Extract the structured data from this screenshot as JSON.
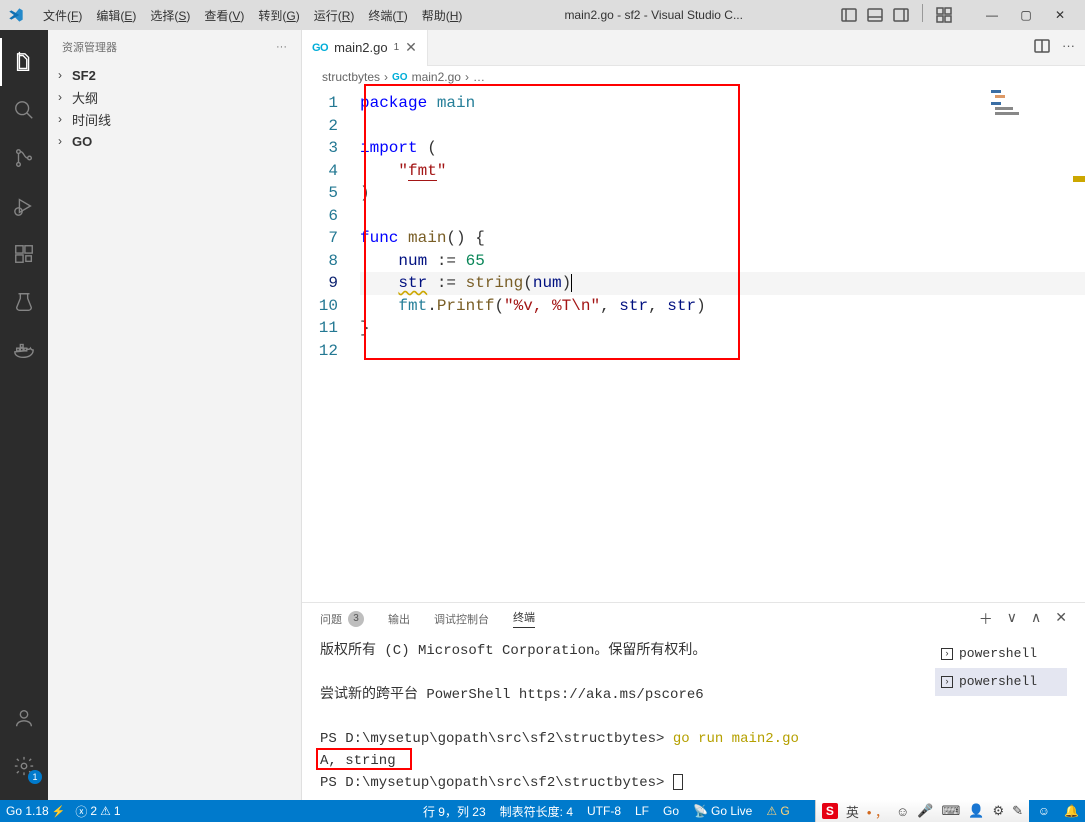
{
  "titlebar": {
    "menu": [
      "文件(F)",
      "编辑(E)",
      "选择(S)",
      "查看(V)",
      "转到(G)",
      "运行(R)",
      "终端(T)",
      "帮助(H)"
    ],
    "title": "main2.go - sf2 - Visual Studio C...",
    "win_btns": {
      "min": "—",
      "max": "▢",
      "close": "✕"
    }
  },
  "sidebar": {
    "head": "资源管理器",
    "items": [
      {
        "label": "SF2",
        "bold": true
      },
      {
        "label": "大纲",
        "bold": false
      },
      {
        "label": "时间线",
        "bold": false
      },
      {
        "label": "GO",
        "bold": true
      }
    ]
  },
  "tab": {
    "file": "main2.go",
    "modified": "1"
  },
  "breadcrumb": [
    "structbytes",
    "main2.go",
    "…"
  ],
  "code": {
    "lines": [
      {
        "n": 1,
        "html": "<span class='tok-kw'>package</span> <span class='tok-pkg'>main</span>"
      },
      {
        "n": 2,
        "html": ""
      },
      {
        "n": 3,
        "html": "<span class='tok-kw'>import</span> ("
      },
      {
        "n": 4,
        "html": "    <span class='tok-str'>\"<span class='underline'>fmt</span>\"</span>"
      },
      {
        "n": 5,
        "html": ")"
      },
      {
        "n": 6,
        "html": ""
      },
      {
        "n": 7,
        "html": "<span class='tok-kw'>func</span> <span class='tok-fn'>main</span>() {"
      },
      {
        "n": 8,
        "html": "    <span class='tok-var'>num</span> := <span class='tok-num'>65</span>"
      },
      {
        "n": 9,
        "cur": true,
        "html": "    <span class='squiggle tok-var'>str</span> := <span class='tok-fn'>string</span>(<span class='tok-var'>num</span>)<span style='border-left:1px solid #000'></span>"
      },
      {
        "n": 10,
        "html": "    <span class='tok-pkg'>fmt</span>.<span class='tok-fn'>Printf</span>(<span class='tok-str'>\"%v, %T\\n\"</span>, <span class='tok-var'>str</span>, <span class='tok-var'>str</span>)"
      },
      {
        "n": 11,
        "html": "}"
      },
      {
        "n": 12,
        "html": ""
      }
    ]
  },
  "panel": {
    "tabs": {
      "problems": "问题",
      "problems_count": "3",
      "output": "输出",
      "debug": "调试控制台",
      "terminal": "终端"
    },
    "terminal_lines": [
      {
        "text": "版权所有 (C) Microsoft Corporation。保留所有权利。"
      },
      {
        "text": ""
      },
      {
        "text": "尝试新的跨平台 PowerShell https://aka.ms/pscore6"
      },
      {
        "text": ""
      },
      {
        "html": "PS D:\\mysetup\\gopath\\src\\sf2\\structbytes&gt; <span class='term-yellow'>go run main2.go</span>"
      },
      {
        "text": "A, string",
        "boxed": true
      },
      {
        "html": "PS D:\\mysetup\\gopath\\src\\sf2\\structbytes&gt; <span style='display:inline-block;width:10px;height:16px;border:1px solid #333;vertical-align:middle;'></span>"
      }
    ],
    "sessions": [
      "powershell",
      "powershell"
    ]
  },
  "statusbar": {
    "go_ver": "Go 1.18",
    "errors": "2",
    "warnings": "1",
    "line_col": "行 9，列 23",
    "tab_size": "制表符长度: 4",
    "encoding": "UTF-8",
    "eol": "LF",
    "lang": "Go",
    "golive": "Go Live",
    "warn_tri": "G"
  },
  "ime": {
    "lang": "英"
  }
}
